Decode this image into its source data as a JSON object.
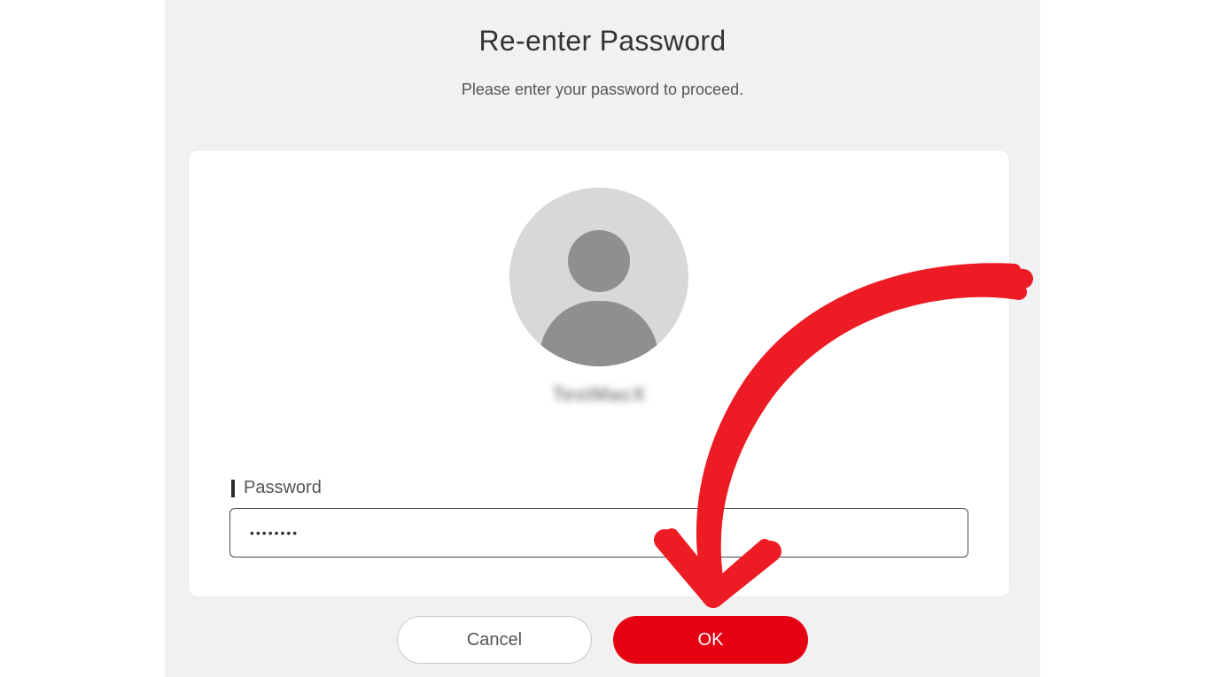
{
  "dialog": {
    "title": "Re-enter Password",
    "subtitle": "Please enter your password to proceed."
  },
  "user": {
    "name": "TestMacX",
    "avatar_icon": "user-silhouette-icon"
  },
  "password_field": {
    "label": "Password",
    "value": "••••••••"
  },
  "buttons": {
    "cancel": "Cancel",
    "ok": "OK"
  },
  "annotation": {
    "arrow_color": "#ed1c24",
    "target": "ok-button"
  }
}
